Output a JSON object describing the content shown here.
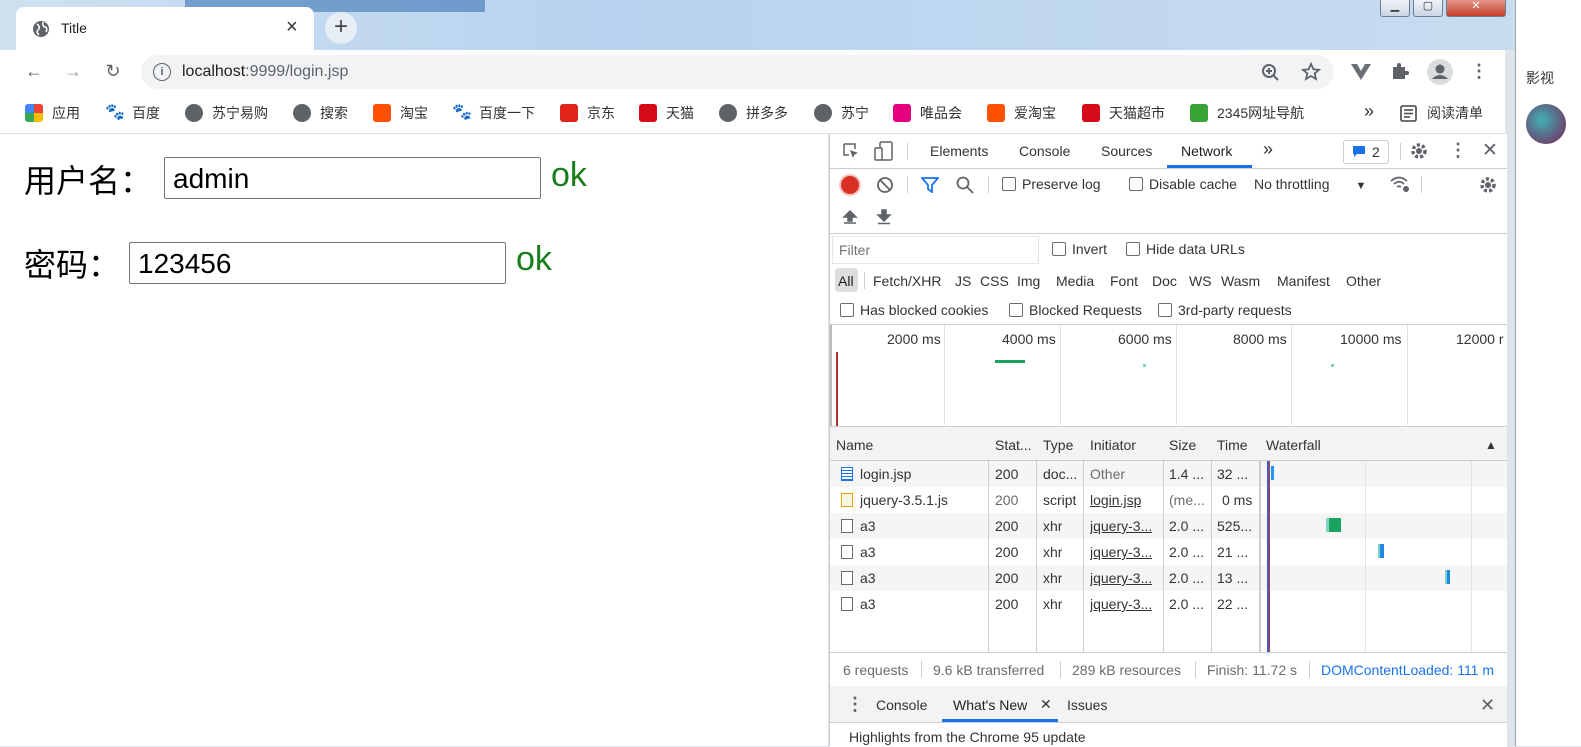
{
  "tab": {
    "title": "Title",
    "close": "×"
  },
  "newtab": "+",
  "window_controls": {
    "minimize": "▁",
    "maximize": "▢",
    "close": "✕"
  },
  "toolbar": {
    "back": "←",
    "forward": "→",
    "reload": "↻",
    "url_host": "localhost",
    "url_rest": ":9999/login.jsp",
    "zoom": "⊕",
    "star": "☆",
    "menu": "⋮"
  },
  "bookmarks": {
    "items": [
      {
        "label": "应用",
        "icon": "apps-icon",
        "color": "#ea4335"
      },
      {
        "label": "百度",
        "icon": "baidu-icon",
        "color": "#2932e1"
      },
      {
        "label": "苏宁易购",
        "icon": "globe-icon",
        "color": "#5f6368"
      },
      {
        "label": "搜索",
        "icon": "globe-icon",
        "color": "#5f6368"
      },
      {
        "label": "淘宝",
        "icon": "taobao-icon",
        "color": "#ff5000"
      },
      {
        "label": "百度一下",
        "icon": "baidu-icon",
        "color": "#2932e1"
      },
      {
        "label": "京东",
        "icon": "jd-icon",
        "color": "#e1251b"
      },
      {
        "label": "天猫",
        "icon": "tmall-icon",
        "color": "#d70a19"
      },
      {
        "label": "拼多多",
        "icon": "globe-icon",
        "color": "#5f6368"
      },
      {
        "label": "苏宁",
        "icon": "globe-icon",
        "color": "#5f6368"
      },
      {
        "label": "唯品会",
        "icon": "vip-icon",
        "color": "#e5007f"
      },
      {
        "label": "爱淘宝",
        "icon": "taobao-icon",
        "color": "#ff5000"
      },
      {
        "label": "天猫超市",
        "icon": "tmall-icon",
        "color": "#d70a19"
      },
      {
        "label": "2345网址导航",
        "icon": "2345-icon",
        "color": "#3aa335"
      }
    ],
    "more": "»",
    "reading_list": "阅读清单"
  },
  "form": {
    "username_label": "用户名：",
    "username_value": "admin",
    "username_status": "ok",
    "password_label": "密码：",
    "password_value": "123456",
    "password_status": "ok"
  },
  "devtools": {
    "tabs": [
      "Elements",
      "Console",
      "Sources",
      "Network"
    ],
    "active_tab": "Network",
    "more_tabs": "»",
    "issues_count": "2",
    "preserve_log": "Preserve log",
    "disable_cache": "Disable cache",
    "throttling": "No throttling",
    "filter_placeholder": "Filter",
    "invert": "Invert",
    "hide_data_urls": "Hide data URLs",
    "type_filters": [
      "All",
      "Fetch/XHR",
      "JS",
      "CSS",
      "Img",
      "Media",
      "Font",
      "Doc",
      "WS",
      "Wasm",
      "Manifest",
      "Other"
    ],
    "has_blocked_cookies": "Has blocked cookies",
    "blocked_requests": "Blocked Requests",
    "third_party": "3rd-party requests",
    "timeline_ticks": [
      "2000 ms",
      "4000 ms",
      "6000 ms",
      "8000 ms",
      "10000 ms",
      "12000 r"
    ],
    "columns": [
      "Name",
      "Stat...",
      "Type",
      "Initiator",
      "Size",
      "Time",
      "Waterfall"
    ],
    "requests": [
      {
        "name": "login.jsp",
        "status": "200",
        "type": "doc...",
        "initiator": "Other",
        "size": "1.4 ...",
        "time": "32 ...",
        "icon": "document-icon"
      },
      {
        "name": "jquery-3.5.1.js",
        "status": "200",
        "type": "script",
        "initiator": "login.jsp",
        "size": "(me...",
        "time": "0 ms",
        "icon": "script-icon"
      },
      {
        "name": "a3",
        "status": "200",
        "type": "xhr",
        "initiator": "jquery-3...",
        "size": "2.0 ...",
        "time": "525...",
        "icon": "file-icon"
      },
      {
        "name": "a3",
        "status": "200",
        "type": "xhr",
        "initiator": "jquery-3...",
        "size": "2.0 ...",
        "time": "21 ...",
        "icon": "file-icon"
      },
      {
        "name": "a3",
        "status": "200",
        "type": "xhr",
        "initiator": "jquery-3...",
        "size": "2.0 ...",
        "time": "13 ...",
        "icon": "file-icon"
      },
      {
        "name": "a3",
        "status": "200",
        "type": "xhr",
        "initiator": "jquery-3...",
        "size": "2.0 ...",
        "time": "22 ...",
        "icon": "file-icon"
      }
    ],
    "summary": {
      "requests": "6 requests",
      "transferred": "9.6 kB transferred",
      "resources": "289 kB resources",
      "finish": "Finish: 11.72 s",
      "dcl": "DOMContentLoaded: 111 m"
    },
    "drawer_tabs": [
      "Console",
      "What's New",
      "Issues"
    ],
    "drawer_active": "What's New",
    "drawer_text": "Highlights from the Chrome 95 update"
  },
  "right_strip": {
    "label": "影视"
  }
}
